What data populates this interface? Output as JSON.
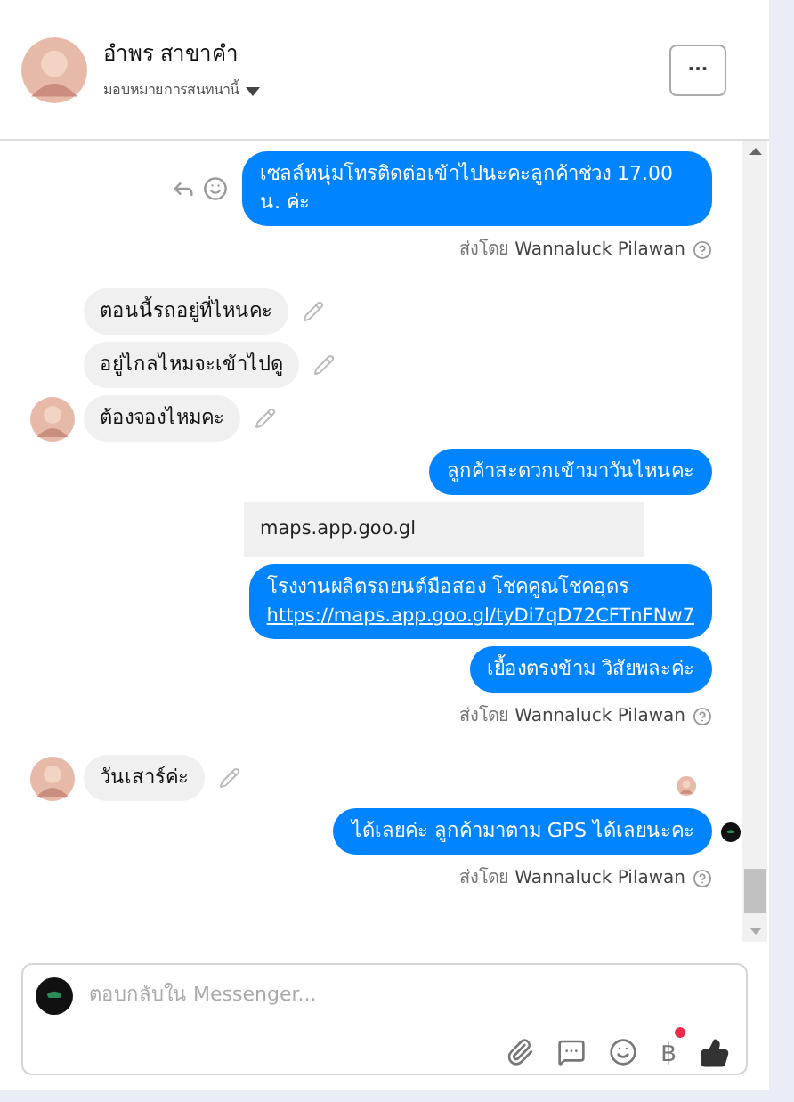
{
  "header": {
    "name": "อำพร สาขาคำ",
    "assign_label": "มอบหมายการสนทนานี้",
    "more_label": "···"
  },
  "messages": [
    {
      "kind": "out",
      "text": "เซลล์หนุ่มโทรติดต่อเข้าไปนะคะลูกค้าช่วง 17.00 น. ค่ะ",
      "actions": true,
      "seen": false
    },
    {
      "kind": "note",
      "prefix": "ส่งโดย",
      "sender": "Wannaluck Pilawan"
    },
    {
      "kind": "in",
      "text": "ตอนนี้รถอยู่ที่ไหนคะ",
      "avatar": false,
      "seen": false
    },
    {
      "kind": "in",
      "text": "อยู่ไกลไหมจะเข้าไปดู",
      "avatar": false,
      "seen": false
    },
    {
      "kind": "in",
      "text": "ต้องจองไหมคะ",
      "avatar": true,
      "seen": false
    },
    {
      "kind": "out",
      "text": "ลูกค้าสะดวกเข้ามาวันไหนคะ",
      "actions": false,
      "seen": false
    },
    {
      "kind": "preview",
      "text": "maps.app.goo.gl"
    },
    {
      "kind": "out",
      "text": "โรงงานผลิตรถยนต์มือสอง โชคคูณโชคอุดร",
      "link": "https://maps.app.goo.gl/tyDi7qD72CFTnFNw7",
      "actions": false,
      "seen": false
    },
    {
      "kind": "out",
      "text": "เยื้องตรงข้าม วิสัยพละค่ะ",
      "actions": false,
      "seen": false
    },
    {
      "kind": "note",
      "prefix": "ส่งโดย",
      "sender": "Wannaluck Pilawan"
    },
    {
      "kind": "in",
      "text": "วันเสาร์ค่ะ",
      "avatar": true,
      "seen": true
    },
    {
      "kind": "out",
      "text": "ได้เลยค่ะ ลูกค้ามาตาม GPS ได้เลยนะคะ",
      "actions": false,
      "seen": true
    },
    {
      "kind": "note",
      "prefix": "ส่งโดย",
      "sender": "Wannaluck Pilawan"
    }
  ],
  "composer": {
    "placeholder": "ตอบกลับใน Messenger...",
    "tools": [
      {
        "kind": "attach"
      },
      {
        "kind": "sticker"
      },
      {
        "kind": "emoji"
      },
      {
        "kind": "payment",
        "label": "฿",
        "badge": true
      },
      {
        "kind": "like"
      }
    ]
  }
}
